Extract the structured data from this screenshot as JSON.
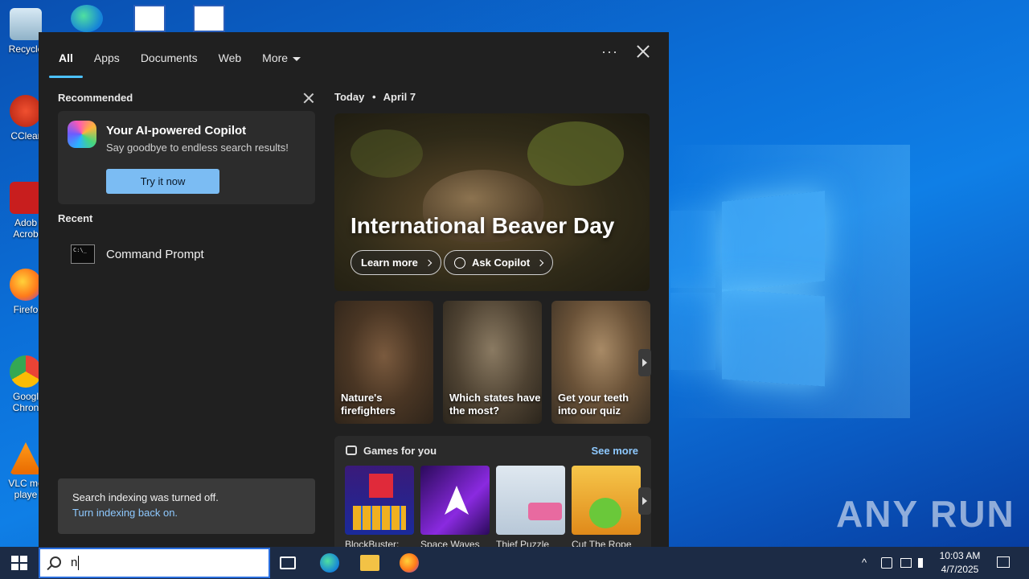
{
  "desktop": {
    "icons": [
      {
        "label": "Recycle"
      },
      {
        "label": "CClear"
      },
      {
        "label": "Adob Acrob"
      },
      {
        "label": "Firefo"
      },
      {
        "label": "Googl Chron"
      },
      {
        "label": "VLC me playe"
      }
    ],
    "watermark": "ANY RUN"
  },
  "search_panel": {
    "tabs": [
      {
        "label": "All",
        "active": true
      },
      {
        "label": "Apps"
      },
      {
        "label": "Documents"
      },
      {
        "label": "Web"
      },
      {
        "label": "More"
      }
    ],
    "more_options": "···",
    "recommended": {
      "heading": "Recommended",
      "copilot_title": "Your AI-powered Copilot",
      "copilot_subtitle": "Say goodbye to endless search results!",
      "try_button": "Try it now"
    },
    "recent": {
      "heading": "Recent",
      "items": [
        {
          "label": "Command Prompt"
        }
      ]
    },
    "indexing": {
      "message": "Search indexing was turned off.",
      "link": "Turn indexing back on."
    },
    "today": {
      "label": "Today",
      "separator": "•",
      "date": "April 7",
      "hero_title": "International Beaver Day",
      "learn_more": "Learn more",
      "ask_copilot": "Ask Copilot"
    },
    "tiles": [
      {
        "caption": "Nature's firefighters"
      },
      {
        "caption": "Which states have the most?"
      },
      {
        "caption": "Get your teeth into our quiz"
      }
    ],
    "games": {
      "heading": "Games for you",
      "see_more": "See more",
      "items": [
        {
          "label": "BlockBuster:"
        },
        {
          "label": "Space Waves"
        },
        {
          "label": "Thief Puzzle"
        },
        {
          "label": "Cut The Rope"
        }
      ]
    }
  },
  "taskbar": {
    "search_value": "n",
    "time": "10:03 AM",
    "date": "4/7/2025"
  }
}
